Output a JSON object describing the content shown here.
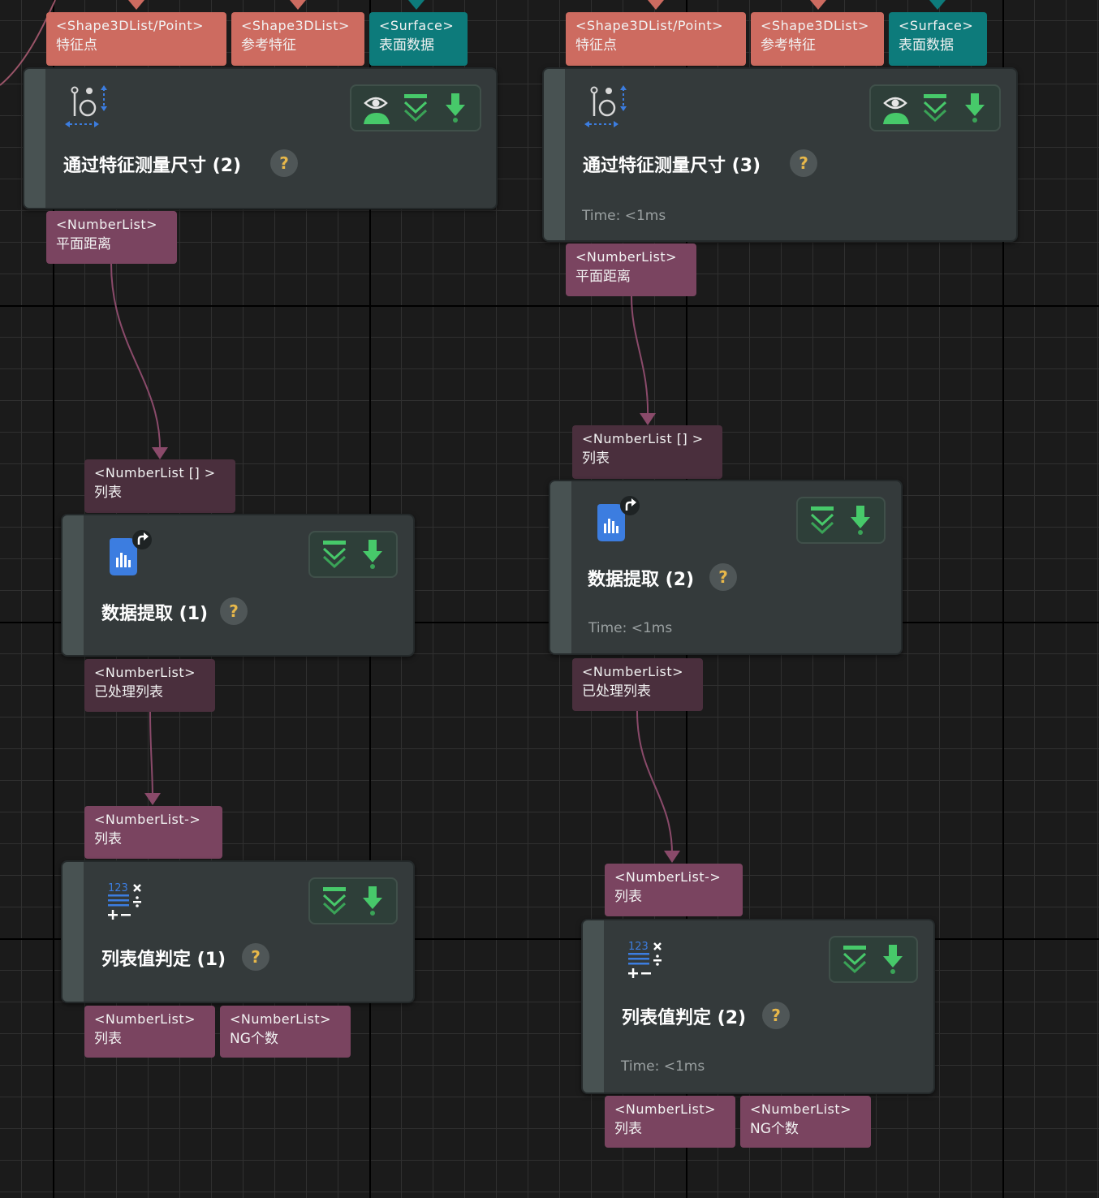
{
  "nodes": {
    "measure2": {
      "title": "通过特征测量尺寸 (2)",
      "help": "?",
      "inputs": [
        {
          "type": "<Shape3DList/Point>",
          "label": "特征点"
        },
        {
          "type": "<Shape3DList>",
          "label": "参考特征"
        },
        {
          "type": "<Surface>",
          "label": "表面数据"
        }
      ],
      "output": {
        "type": "<NumberList>",
        "label": "平面距离"
      }
    },
    "measure3": {
      "title": "通过特征测量尺寸 (3)",
      "help": "?",
      "time": "Time: <1ms",
      "inputs": [
        {
          "type": "<Shape3DList/Point>",
          "label": "特征点"
        },
        {
          "type": "<Shape3DList>",
          "label": "参考特征"
        },
        {
          "type": "<Surface>",
          "label": "表面数据"
        }
      ],
      "output": {
        "type": "<NumberList>",
        "label": "平面距离"
      }
    },
    "extract1": {
      "title": "数据提取 (1)",
      "help": "?",
      "input": {
        "type": "<NumberList [] >",
        "label": "列表"
      },
      "output": {
        "type": "<NumberList>",
        "label": "已处理列表"
      }
    },
    "extract2": {
      "title": "数据提取 (2)",
      "help": "?",
      "time": "Time: <1ms",
      "input": {
        "type": "<NumberList [] >",
        "label": "列表"
      },
      "output": {
        "type": "<NumberList>",
        "label": "已处理列表"
      }
    },
    "judge1": {
      "title": "列表值判定 (1)",
      "help": "?",
      "input": {
        "type": "<NumberList->",
        "label": "列表"
      },
      "outputs": [
        {
          "type": "<NumberList>",
          "label": "列表"
        },
        {
          "type": "<NumberList>",
          "label": "NG个数"
        }
      ]
    },
    "judge2": {
      "title": "列表值判定 (2)",
      "help": "?",
      "time": "Time: <1ms",
      "input": {
        "type": "<NumberList->",
        "label": "列表"
      },
      "outputs": [
        {
          "type": "<NumberList>",
          "label": "列表"
        },
        {
          "type": "<NumberList>",
          "label": "NG个数"
        }
      ]
    }
  },
  "colors": {
    "port_shape": "#cd6b60",
    "port_surface": "#0d7b7b",
    "port_number": "#7a4460",
    "wire": "#8a4a6a",
    "tool_green": "#47c96a"
  },
  "icons": [
    "measure-icon",
    "data-extract-icon",
    "list-judge-icon",
    "eye-icon",
    "collapse-icon",
    "download-icon",
    "help-icon"
  ]
}
